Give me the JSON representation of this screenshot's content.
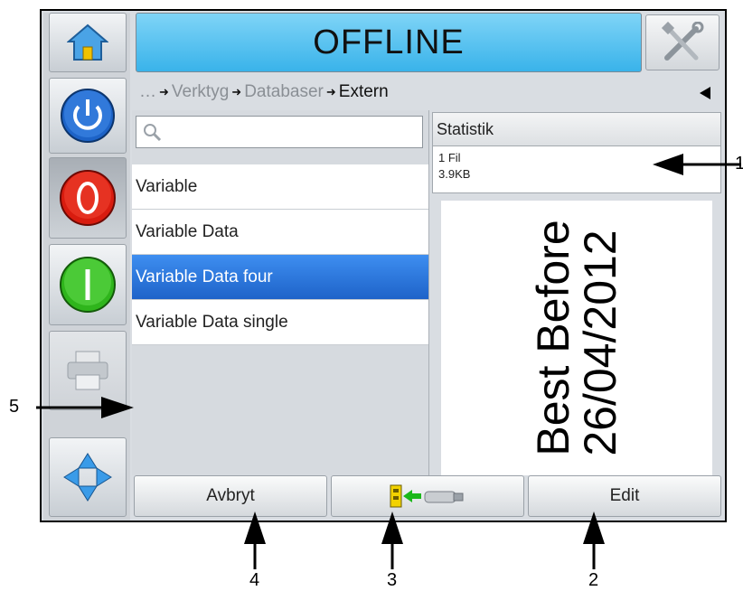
{
  "status": {
    "title": "OFFLINE",
    "color": "#39b3ea"
  },
  "breadcrumb": {
    "ellipsis": "…",
    "items": [
      "Verktyg",
      "Databaser"
    ],
    "current": "Extern"
  },
  "search": {
    "placeholder": "",
    "value": ""
  },
  "list": {
    "items": [
      "Variable",
      "Variable Data",
      "Variable Data four",
      "Variable Data single"
    ],
    "selected": "Variable Data four"
  },
  "stats": {
    "header": "Statistik",
    "files": "1 Fil",
    "size": "3.9KB"
  },
  "preview": {
    "line1": "Best Before",
    "line2": "26/04/2012"
  },
  "bottom": {
    "cancel_label": "Avbryt",
    "import_icon": "import-from-usb-icon",
    "edit_label": "Edit"
  },
  "sidebar": {
    "icons": [
      "home-icon",
      "power-icon",
      "stop-icon",
      "start-icon",
      "printer-icon",
      "navigation-arrows-icon"
    ]
  },
  "callouts": {
    "c1": "1",
    "c2": "2",
    "c3": "3",
    "c4": "4",
    "c5": "5"
  }
}
